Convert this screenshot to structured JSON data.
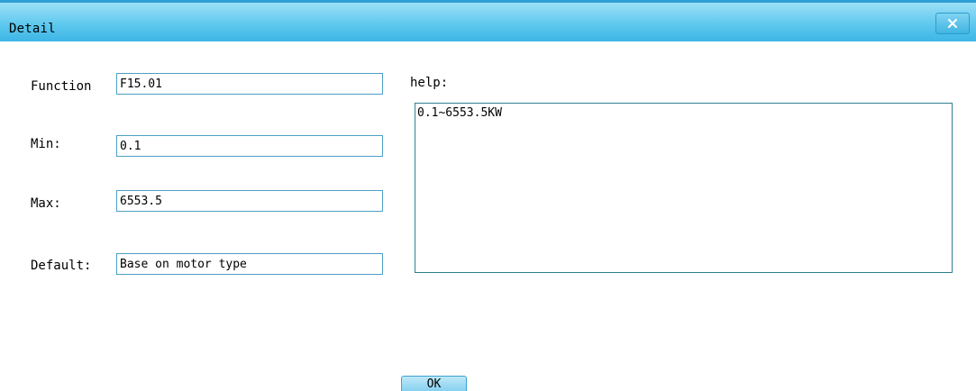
{
  "window": {
    "title": "Detail",
    "close_icon": "close-x-icon"
  },
  "fields": {
    "function": {
      "label": "Function",
      "value": "F15.01"
    },
    "min": {
      "label": "Min:",
      "value": "0.1"
    },
    "max": {
      "label": "Max:",
      "value": "6553.5"
    },
    "default": {
      "label": "Default:",
      "value": "Base on motor type"
    }
  },
  "help": {
    "label": "help:",
    "text": "0.1~6553.5KW"
  },
  "buttons": {
    "ok_label": "OK"
  },
  "colors": {
    "titlebar": "#5fc9ee",
    "input_border": "#4d9fc4",
    "help_border": "#2f7f8f"
  }
}
